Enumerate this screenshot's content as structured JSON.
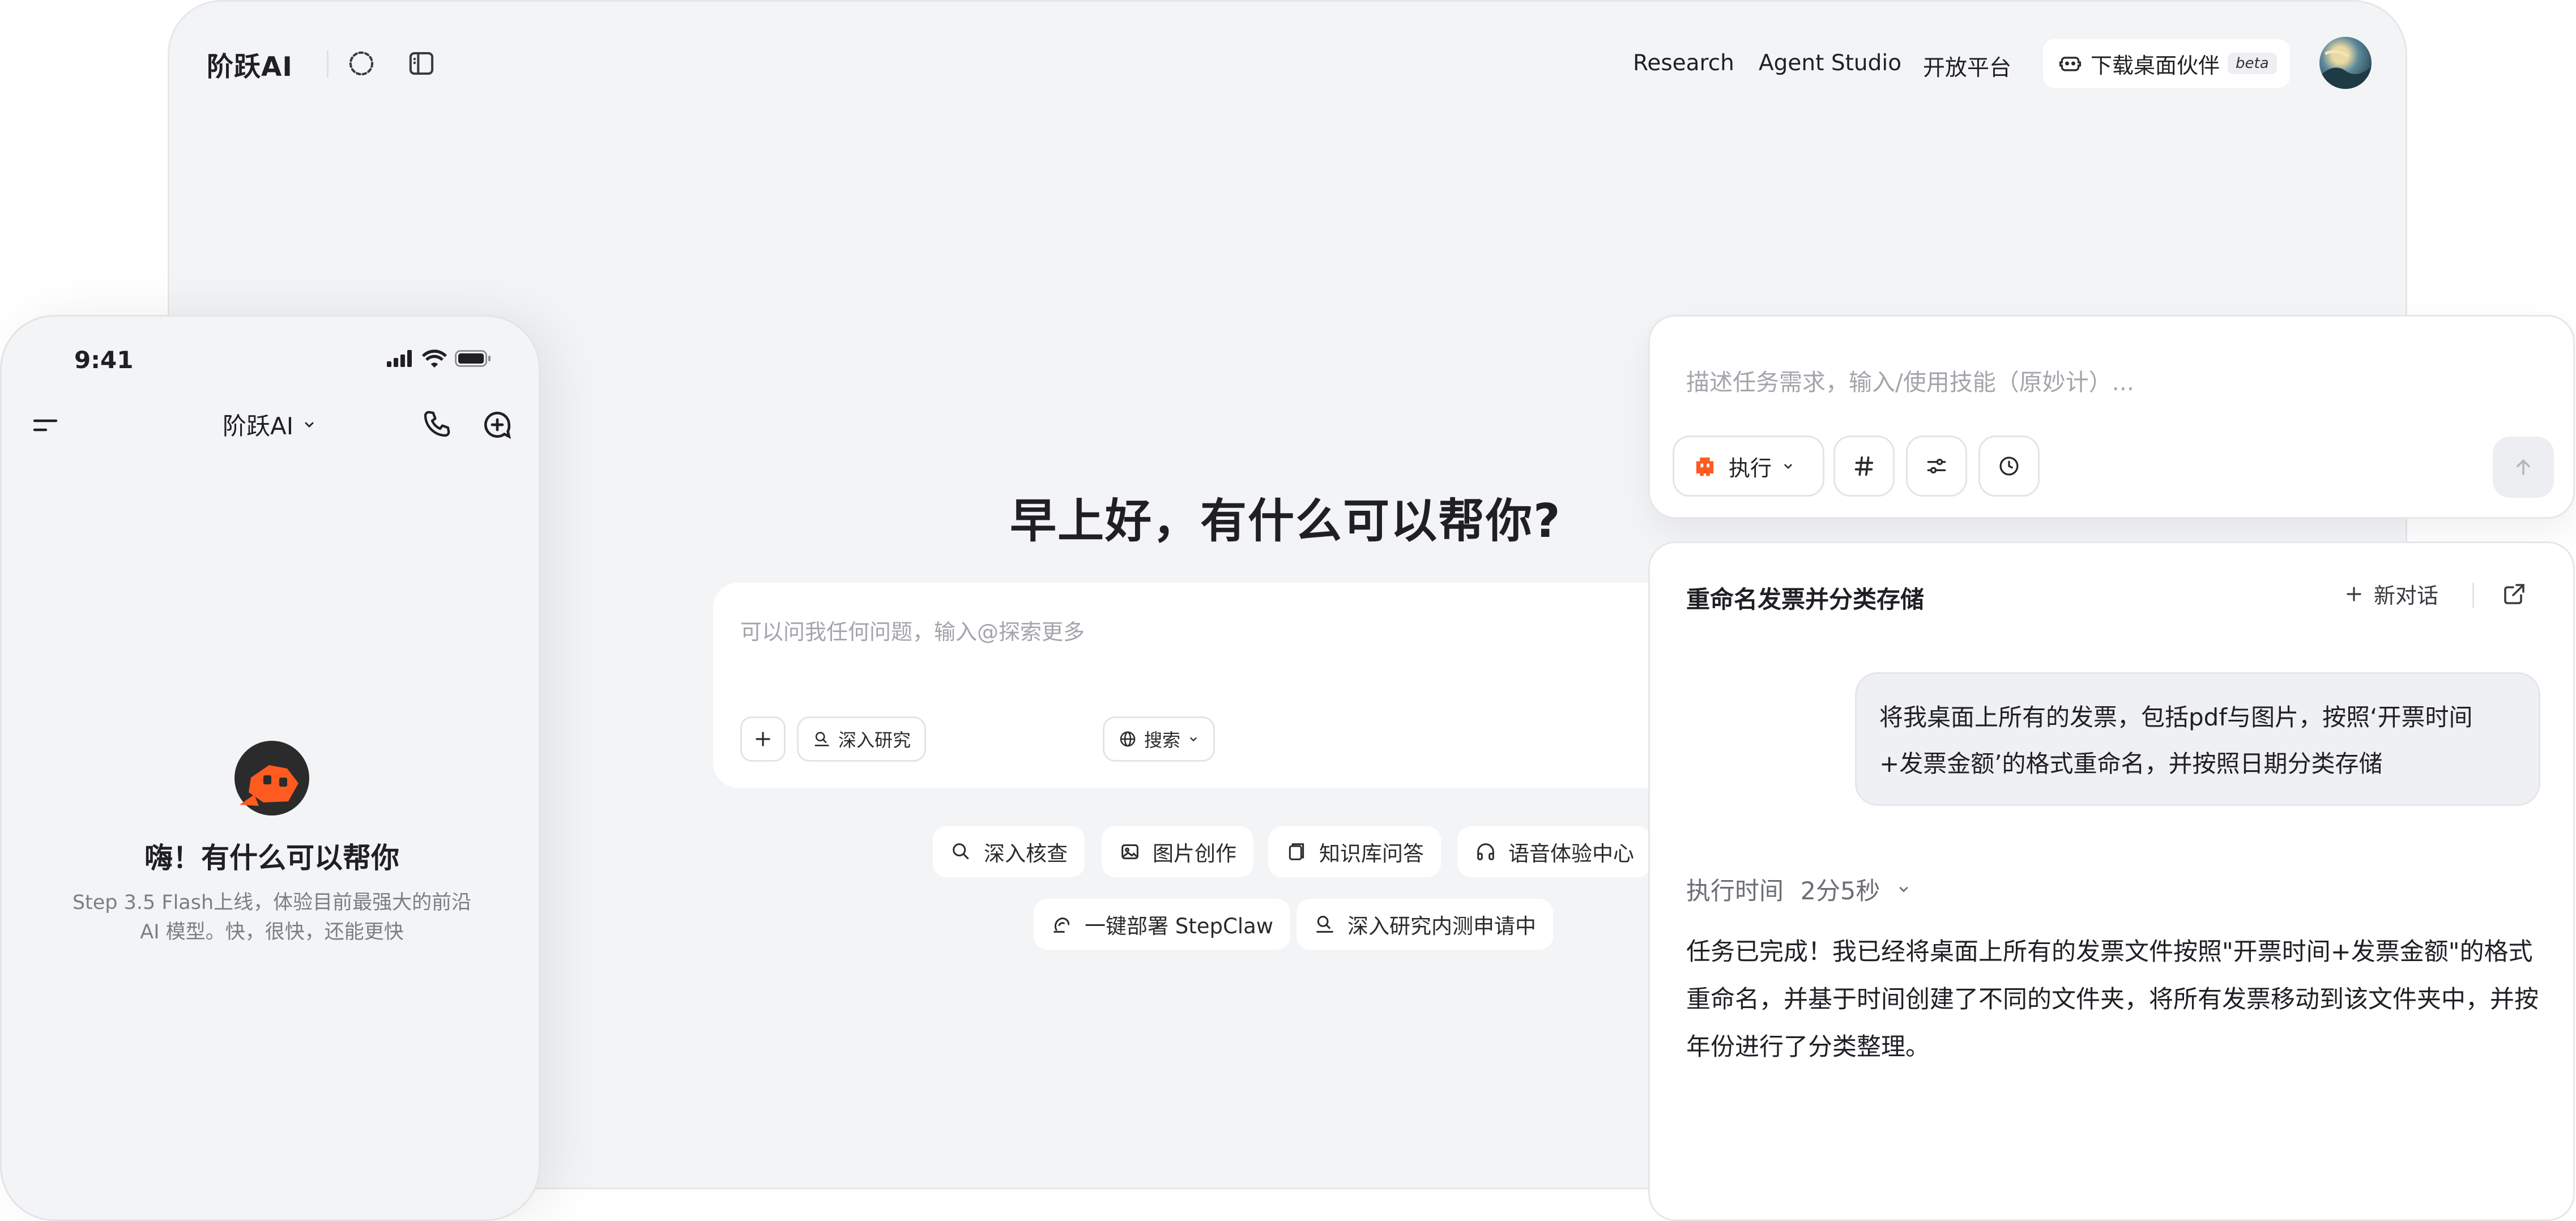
{
  "desktop": {
    "logo": "阶跃AI",
    "nav": {
      "research": "Research",
      "agent_studio": "Agent Studio",
      "open_platform": "开放平台"
    },
    "download": {
      "label": "下载桌面伙伴",
      "badge": "beta"
    },
    "greeting": "早上好，有什么可以帮你?",
    "input": {
      "placeholder": "可以问我任何问题，输入@探索更多",
      "chips": {
        "deep_research": "深入研究",
        "search": "搜索"
      }
    },
    "suggestions": [
      {
        "label": "深入核查",
        "icon": "search-check-icon"
      },
      {
        "label": "图片创作",
        "icon": "image-icon"
      },
      {
        "label": "知识库问答",
        "icon": "book-icon"
      },
      {
        "label": "语音体验中心",
        "icon": "headphones-icon"
      },
      {
        "label": "一键部署 StepClaw",
        "icon": "claw-icon"
      },
      {
        "label": "深入研究内测申请中",
        "icon": "deep-research-icon"
      }
    ]
  },
  "phone": {
    "time": "9:41",
    "title": "阶跃AI",
    "greeting": "嗨！有什么可以帮你",
    "desc_line1": "Step 3.5 Flash上线，体验目前最强大的前沿",
    "desc_line2": "AI 模型。快，很快，还能更快"
  },
  "task_panel": {
    "placeholder": "描述任务需求，输入/使用技能（原妙计）...",
    "exec_label": "执行"
  },
  "chat_panel": {
    "title": "重命名发票并分类存储",
    "new_chat": "新对话",
    "user_message_line1": "将我桌面上所有的发票，包括pdf与图片，按照‘开票时间",
    "user_message_line2": "+发票金额’的格式重命名，并按照日期分类存储",
    "exec_time_label": "执行时间",
    "exec_time_value": "2分5秒",
    "result": "任务已完成！我已经将桌面上所有的发票文件按照\"开票时间+发票金额\"的格式重命名，并基于时间创建了不同的文件夹，将所有发票移动到该文件夹中，并按年份进行了分类整理。"
  },
  "colors": {
    "brand_orange": "#ff5a1f",
    "dark": "#1f1f24",
    "bg": "#f3f4f6"
  }
}
